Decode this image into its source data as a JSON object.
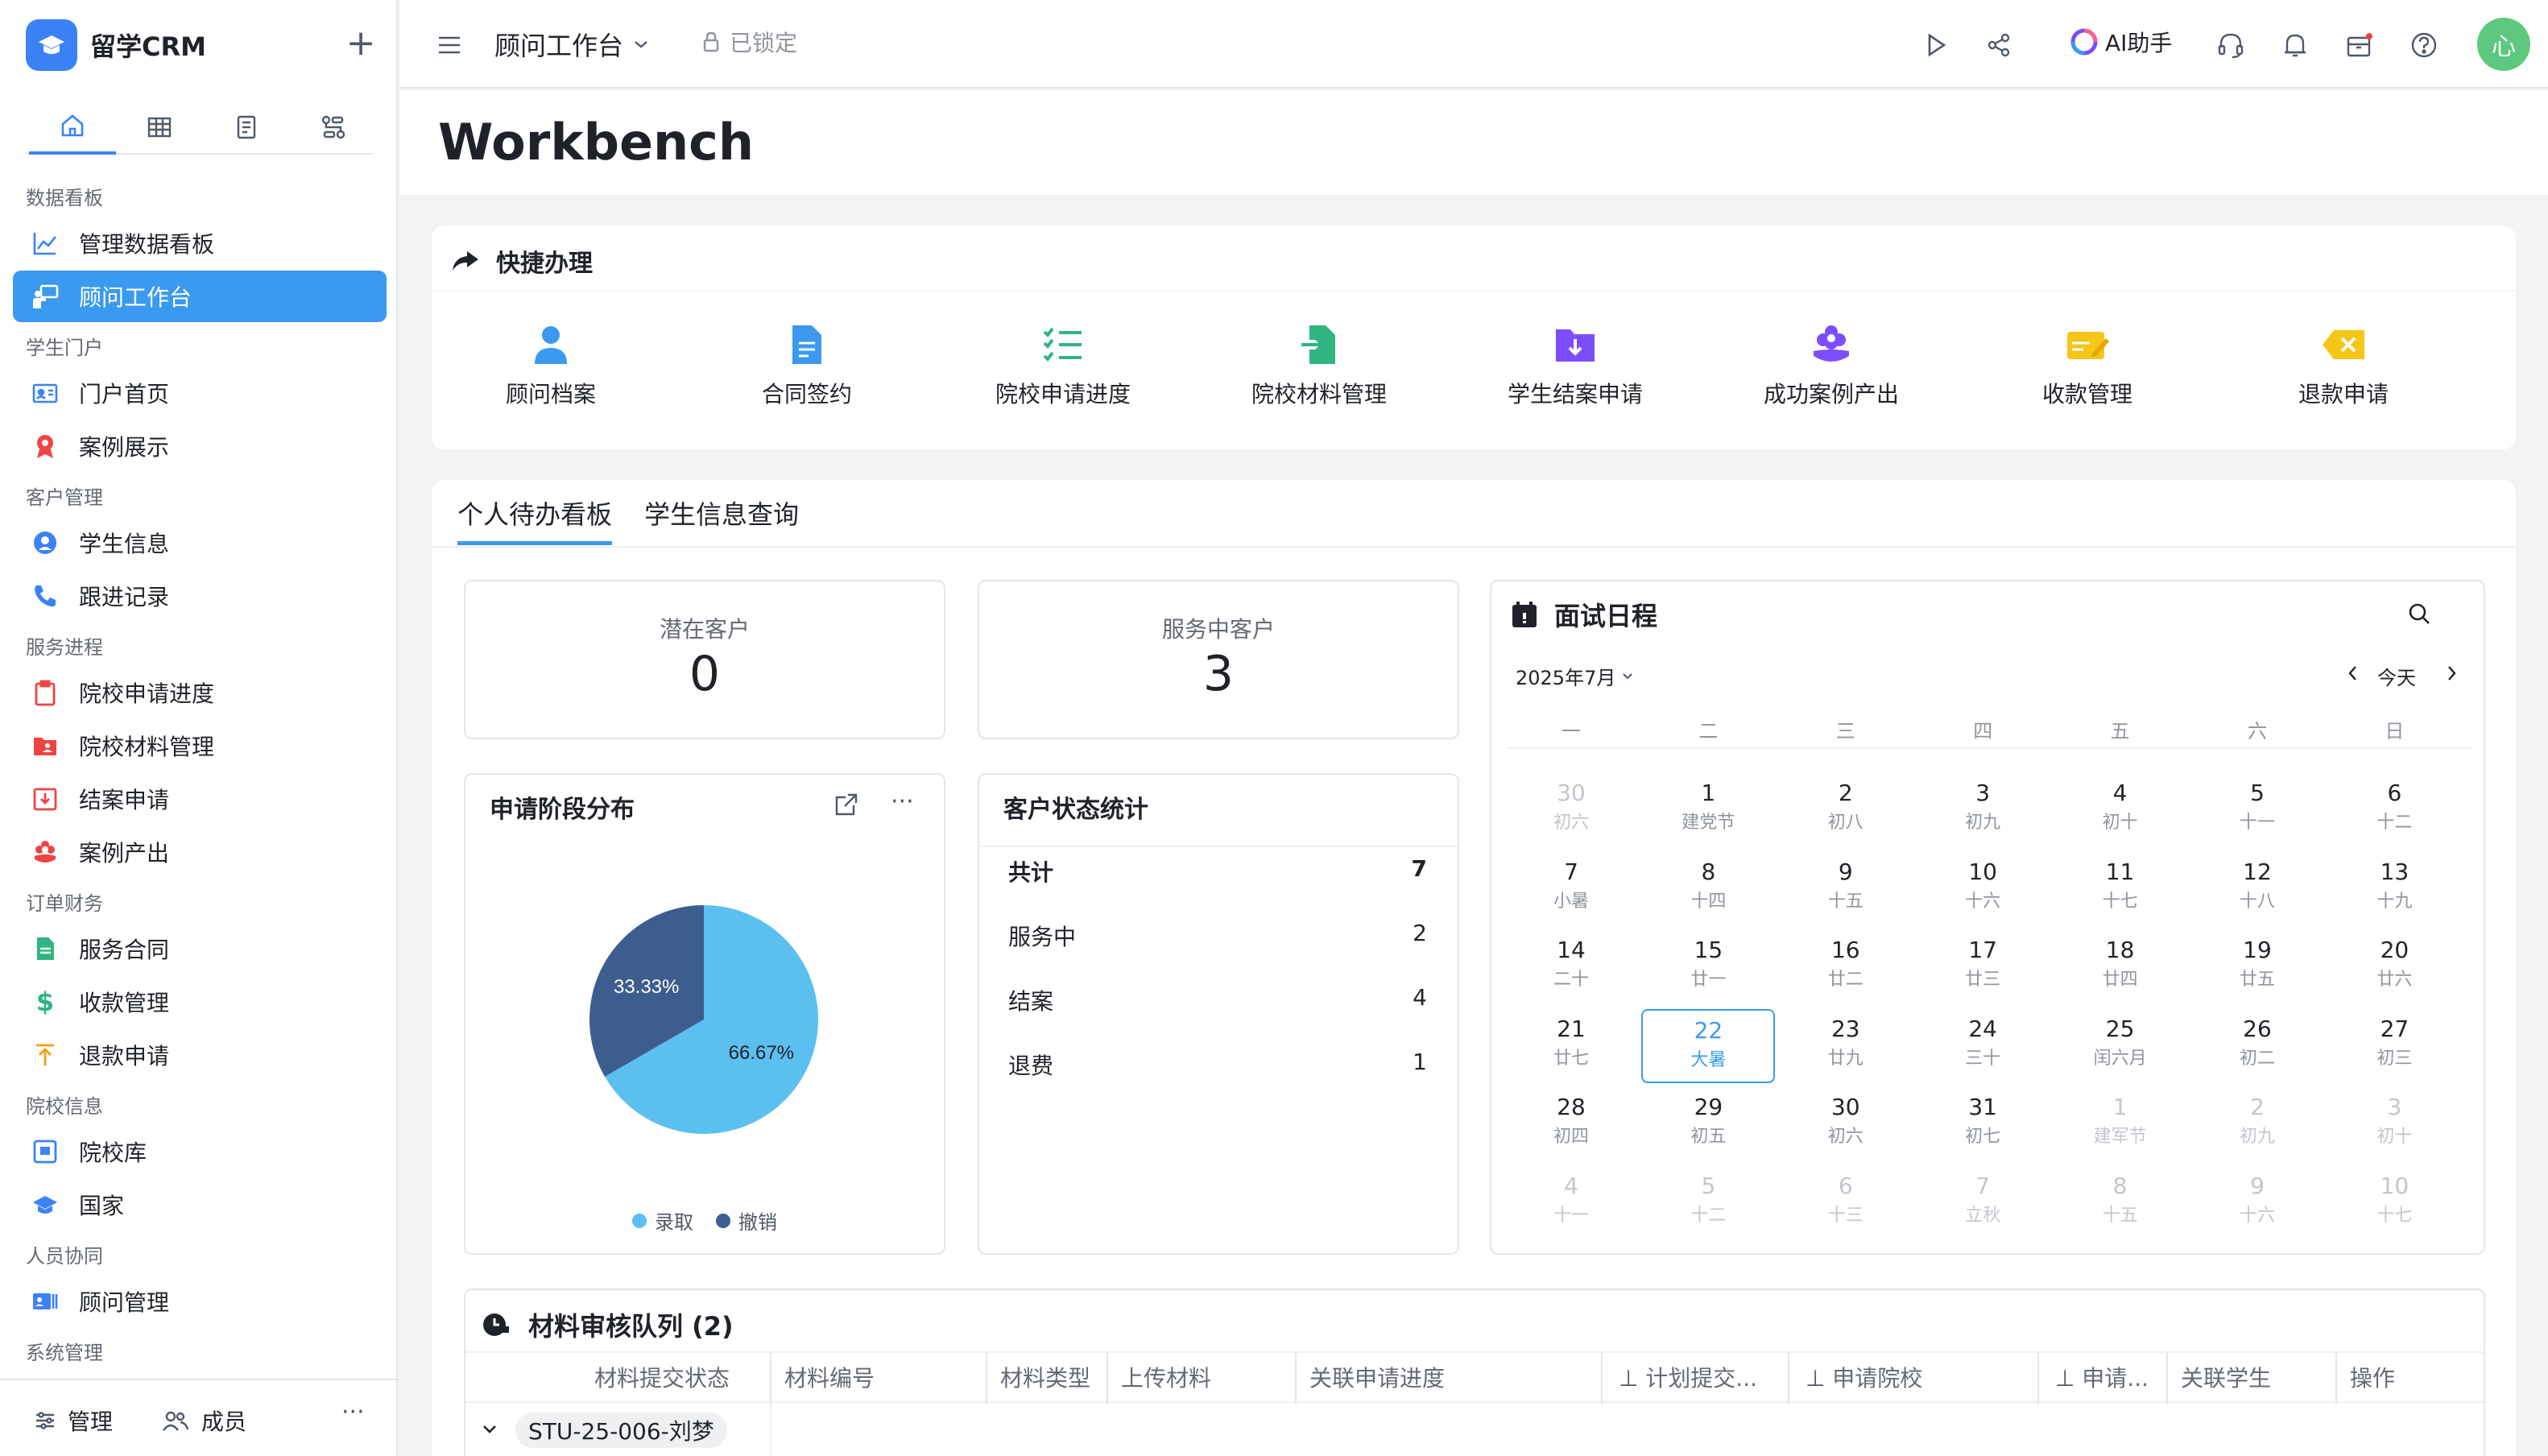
{
  "app": {
    "name": "留学CRM"
  },
  "sidebar": {
    "groups": [
      {
        "label": "数据看板",
        "items": [
          {
            "label": "管理数据看板"
          },
          {
            "label": "顾问工作台"
          }
        ]
      },
      {
        "label": "学生门户",
        "items": [
          {
            "label": "门户首页"
          },
          {
            "label": "案例展示"
          }
        ]
      },
      {
        "label": "客户管理",
        "items": [
          {
            "label": "学生信息"
          },
          {
            "label": "跟进记录"
          }
        ]
      },
      {
        "label": "服务进程",
        "items": [
          {
            "label": "院校申请进度"
          },
          {
            "label": "院校材料管理"
          },
          {
            "label": "结案申请"
          },
          {
            "label": "案例产出"
          }
        ]
      },
      {
        "label": "订单财务",
        "items": [
          {
            "label": "服务合同"
          },
          {
            "label": "收款管理"
          },
          {
            "label": "退款申请"
          }
        ]
      },
      {
        "label": "院校信息",
        "items": [
          {
            "label": "院校库"
          },
          {
            "label": "国家"
          }
        ]
      },
      {
        "label": "人员协同",
        "items": [
          {
            "label": "顾问管理"
          }
        ]
      },
      {
        "label": "系统管理",
        "items": []
      }
    ],
    "footer": {
      "manage": "管理",
      "members": "成员"
    }
  },
  "topbar": {
    "workspace": "顾问工作台",
    "lock": "已锁定",
    "ai": "AI助手",
    "avatar": "心"
  },
  "page": {
    "title": "Workbench"
  },
  "quick": {
    "title": "快捷办理",
    "items": [
      {
        "label": "顾问档案",
        "icon": "user-icon",
        "color": "#3b9af0"
      },
      {
        "label": "合同签约",
        "icon": "document-icon",
        "color": "#3b9af0"
      },
      {
        "label": "院校申请进度",
        "icon": "checklist-icon",
        "color": "#2fb57f"
      },
      {
        "label": "院校材料管理",
        "icon": "file-import-icon",
        "color": "#2fb57f"
      },
      {
        "label": "学生结案申请",
        "icon": "folder-download-icon",
        "color": "#7c4dff"
      },
      {
        "label": "成功案例产出",
        "icon": "flower-icon",
        "color": "#7c4dff"
      },
      {
        "label": "收款管理",
        "icon": "pen-card-icon",
        "color": "#f5c518"
      },
      {
        "label": "退款申请",
        "icon": "backspace-icon",
        "color": "#f5c518"
      }
    ]
  },
  "panel": {
    "tabs": [
      "个人待办看板",
      "学生信息查询"
    ]
  },
  "stats": {
    "potential": {
      "label": "潜在客户",
      "value": "0"
    },
    "serving": {
      "label": "服务中客户",
      "value": "3"
    }
  },
  "pie": {
    "title": "申请阶段分布"
  },
  "chart_data": {
    "type": "pie",
    "categories": [
      "录取",
      "撤销"
    ],
    "values": [
      66.67,
      33.33
    ],
    "colors": [
      "#5bc0f0",
      "#3e5d8f"
    ],
    "labels": [
      "66.67%",
      "33.33%"
    ],
    "legend": "bottom"
  },
  "status": {
    "title": "客户状态统计",
    "rows": [
      {
        "label": "共计",
        "value": "7"
      },
      {
        "label": "服务中",
        "value": "2"
      },
      {
        "label": "结案",
        "value": "4"
      },
      {
        "label": "退费",
        "value": "1"
      }
    ]
  },
  "calendar": {
    "title": "面试日程",
    "month": "2025年7月",
    "today_label": "今天",
    "weekdays": [
      "一",
      "二",
      "三",
      "四",
      "五",
      "六",
      "日"
    ],
    "weeks": [
      [
        {
          "d": "30",
          "l": "初六",
          "m": 1
        },
        {
          "d": "1",
          "l": "建党节"
        },
        {
          "d": "2",
          "l": "初八"
        },
        {
          "d": "3",
          "l": "初九"
        },
        {
          "d": "4",
          "l": "初十"
        },
        {
          "d": "5",
          "l": "十一"
        },
        {
          "d": "6",
          "l": "十二"
        }
      ],
      [
        {
          "d": "7",
          "l": "小暑"
        },
        {
          "d": "8",
          "l": "十四"
        },
        {
          "d": "9",
          "l": "十五"
        },
        {
          "d": "10",
          "l": "十六"
        },
        {
          "d": "11",
          "l": "十七"
        },
        {
          "d": "12",
          "l": "十八"
        },
        {
          "d": "13",
          "l": "十九"
        }
      ],
      [
        {
          "d": "14",
          "l": "二十"
        },
        {
          "d": "15",
          "l": "廿一"
        },
        {
          "d": "16",
          "l": "廿二"
        },
        {
          "d": "17",
          "l": "廿三"
        },
        {
          "d": "18",
          "l": "廿四"
        },
        {
          "d": "19",
          "l": "廿五"
        },
        {
          "d": "20",
          "l": "廿六"
        }
      ],
      [
        {
          "d": "21",
          "l": "廿七"
        },
        {
          "d": "22",
          "l": "大暑",
          "t": 1
        },
        {
          "d": "23",
          "l": "廿九"
        },
        {
          "d": "24",
          "l": "三十"
        },
        {
          "d": "25",
          "l": "闰六月"
        },
        {
          "d": "26",
          "l": "初二"
        },
        {
          "d": "27",
          "l": "初三"
        }
      ],
      [
        {
          "d": "28",
          "l": "初四"
        },
        {
          "d": "29",
          "l": "初五"
        },
        {
          "d": "30",
          "l": "初六"
        },
        {
          "d": "31",
          "l": "初七"
        },
        {
          "d": "1",
          "l": "建军节",
          "m": 1
        },
        {
          "d": "2",
          "l": "初九",
          "m": 1
        },
        {
          "d": "3",
          "l": "初十",
          "m": 1
        }
      ],
      [
        {
          "d": "4",
          "l": "十一",
          "m": 1
        },
        {
          "d": "5",
          "l": "十二",
          "m": 1
        },
        {
          "d": "6",
          "l": "十三",
          "m": 1
        },
        {
          "d": "7",
          "l": "立秋",
          "m": 1
        },
        {
          "d": "8",
          "l": "十五",
          "m": 1
        },
        {
          "d": "9",
          "l": "十六",
          "m": 1
        },
        {
          "d": "10",
          "l": "十七",
          "m": 1
        }
      ]
    ]
  },
  "queue": {
    "title": "材料审核队列 (2)",
    "columns": [
      "材料提交状态",
      "材料编号",
      "材料类型",
      "上传材料",
      "关联申请进度",
      "计划提交...",
      "申请院校",
      "申请...",
      "关联学生",
      "操作"
    ],
    "group_tag": "STU-25-006-刘梦"
  }
}
